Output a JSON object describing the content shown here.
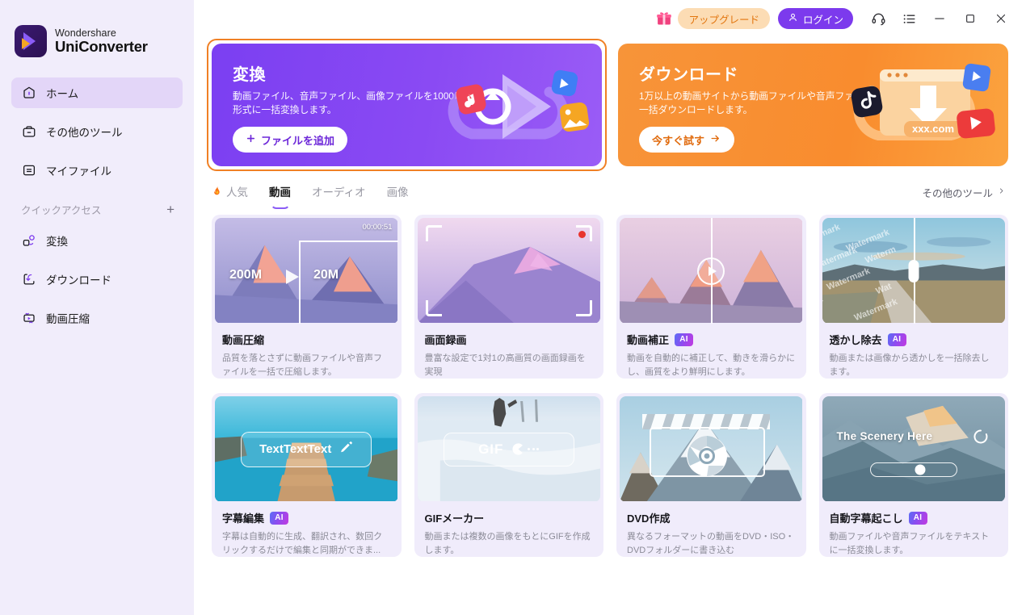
{
  "brand": {
    "top": "Wondershare",
    "bottom": "UniConverter"
  },
  "sidebar": {
    "items": [
      {
        "label": "ホーム",
        "icon": "home-icon",
        "active": true
      },
      {
        "label": "その他のツール",
        "icon": "toolbox-icon",
        "active": false
      },
      {
        "label": "マイファイル",
        "icon": "files-icon",
        "active": false
      }
    ],
    "quick_access": {
      "label": "クイックアクセス",
      "add_icon": "plus-icon"
    },
    "quick_items": [
      {
        "label": "変換",
        "icon": "convert-icon"
      },
      {
        "label": "ダウンロード",
        "icon": "download-icon"
      },
      {
        "label": "動画圧縮",
        "icon": "compress-icon"
      }
    ]
  },
  "titlebar": {
    "gift_icon": "gift-icon",
    "upgrade_label": "アップグレード",
    "login_label": "ログイン",
    "login_icon": "user-icon",
    "support_icon": "headset-icon",
    "menu_icon": "list-menu-icon",
    "minimize_icon": "minimize-icon",
    "maximize_icon": "maximize-icon",
    "close_icon": "close-icon"
  },
  "banners": [
    {
      "title": "変換",
      "desc": "動画ファイル、音声ファイル、画像ファイルを1000以上の形式に一括変換します。",
      "button": "ファイルを追加",
      "button_icon": "plus-icon",
      "color": "#7b3ff2",
      "focused": true
    },
    {
      "title": "ダウンロード",
      "desc": "1万以上の動画サイトから動画ファイルや音声ファイルを一括ダウンロードします。",
      "button": "今すぐ試す",
      "button_icon": "arrow-right-icon",
      "color": "#f79439",
      "focused": false
    }
  ],
  "tabs": [
    {
      "label": "人気",
      "icon": "flame-icon",
      "active": false
    },
    {
      "label": "動画",
      "icon": "",
      "active": true
    },
    {
      "label": "オーディオ",
      "icon": "",
      "active": false
    },
    {
      "label": "画像",
      "icon": "",
      "active": false
    }
  ],
  "more_tools": {
    "label": "その他のツール",
    "icon": "chevron-right-icon"
  },
  "cards": [
    {
      "title": "動画圧縮",
      "ai": false,
      "desc": "品質を落とさずに動画ファイルや音声ファイルを一括で圧縮します。",
      "thumb": {
        "kind": "compress",
        "time": "00:00:51",
        "before": "200M",
        "after": "20M"
      }
    },
    {
      "title": "画面録画",
      "ai": false,
      "desc": "豊富な設定で1対1の高画質の画面録画を実現",
      "thumb": {
        "kind": "record"
      }
    },
    {
      "title": "動画補正",
      "ai": true,
      "ai_label": "AI",
      "desc": "動画を自動的に補正して、動きを滑らかにし、画質をより鮮明にします。",
      "thumb": {
        "kind": "enhance"
      }
    },
    {
      "title": "透かし除去",
      "ai": true,
      "ai_label": "AI",
      "desc": "動画または画像から透かしを一括除去します。",
      "thumb": {
        "kind": "watermark",
        "watermark_text": "Watermark"
      }
    },
    {
      "title": "字幕編集",
      "ai": true,
      "ai_label": "AI",
      "desc": "字幕は自動的に生成、翻訳され、数回クリックするだけで編集と同期ができま...",
      "thumb": {
        "kind": "subtitle",
        "overlay_text": "TextTextText",
        "overlay_icon": "pencil-icon"
      }
    },
    {
      "title": "GIFメーカー",
      "ai": false,
      "desc": "動画または複数の画像をもとにGIFを作成します。",
      "thumb": {
        "kind": "gif",
        "overlay_text": "GIF",
        "overlay_icon": "pacman-icon"
      }
    },
    {
      "title": "DVD作成",
      "ai": false,
      "desc": "異なるフォーマットの動画をDVD・ISO・DVDフォルダーに書き込む",
      "thumb": {
        "kind": "dvd",
        "overlay_icon": "disc-icon"
      }
    },
    {
      "title": "自動字幕起こし",
      "ai": true,
      "ai_label": "AI",
      "desc": "動画ファイルや音声ファイルをテキストに一括変換します。",
      "thumb": {
        "kind": "transcribe",
        "overlay_text": "The Scenery Here",
        "overlay_icon": "spinner-icon"
      }
    }
  ],
  "colors": {
    "accent_purple": "#7c3aed",
    "accent_orange": "#f08025",
    "sidebar_bg": "#f1edfb",
    "card_bg": "#f0ecfb",
    "upgrade_bg": "#fcdcb4",
    "upgrade_text": "#e2750e"
  }
}
